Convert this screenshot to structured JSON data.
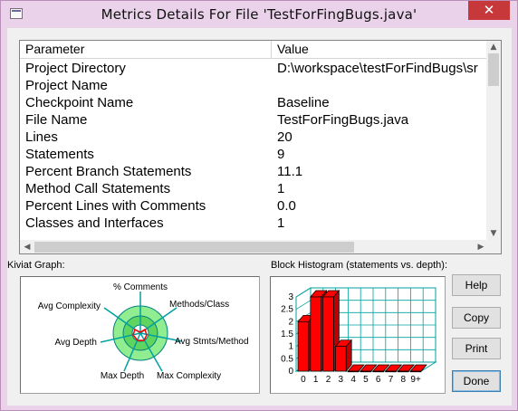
{
  "window": {
    "title": "Metrics Details For File 'TestForFingBugs.java'",
    "close_glyph": "✕"
  },
  "table": {
    "headers": [
      "Parameter",
      "Value"
    ],
    "rows": [
      {
        "param": "Project Directory",
        "value": "D:\\workspace\\testForFindBugs\\sr"
      },
      {
        "param": "Project Name",
        "value": ""
      },
      {
        "param": "Checkpoint Name",
        "value": "Baseline"
      },
      {
        "param": "File Name",
        "value": "TestForFingBugs.java"
      },
      {
        "param": "Lines",
        "value": "20"
      },
      {
        "param": "Statements",
        "value": "9"
      },
      {
        "param": "Percent Branch Statements",
        "value": "11.1"
      },
      {
        "param": "Method Call Statements",
        "value": "1"
      },
      {
        "param": "Percent Lines with Comments",
        "value": "0.0"
      },
      {
        "param": "Classes and Interfaces",
        "value": "1"
      }
    ]
  },
  "kiviat": {
    "label": "Kiviat Graph:",
    "axes": [
      "% Comments",
      "Methods/Class",
      "Avg Stmts/Method",
      "Max Complexity",
      "Max Depth",
      "Avg Depth",
      "Avg Complexity"
    ],
    "colors": {
      "outer_ring": "#90ee90",
      "inner_ring": "#5fd55f",
      "spokes": "#00a0a0",
      "values": "#ff0000"
    }
  },
  "histogram": {
    "label": "Block Histogram (statements vs. depth):",
    "x_ticks": [
      "0",
      "1",
      "2",
      "3",
      "4",
      "5",
      "6",
      "7",
      "8",
      "9+"
    ],
    "y_ticks": [
      "0",
      "0.5",
      "1",
      "1.5",
      "2",
      "2.5",
      "3"
    ],
    "bar_color": "#ff0000"
  },
  "chart_data": {
    "type": "bar",
    "title": "Block Histogram (statements vs. depth):",
    "categories": [
      "0",
      "1",
      "2",
      "3",
      "4",
      "5",
      "6",
      "7",
      "8",
      "9+"
    ],
    "values": [
      2,
      3,
      3,
      1,
      0,
      0,
      0,
      0,
      0,
      0
    ],
    "ylim": [
      0,
      3
    ]
  },
  "buttons": {
    "help": "Help",
    "copy": "Copy",
    "print": "Print",
    "done": "Done"
  }
}
